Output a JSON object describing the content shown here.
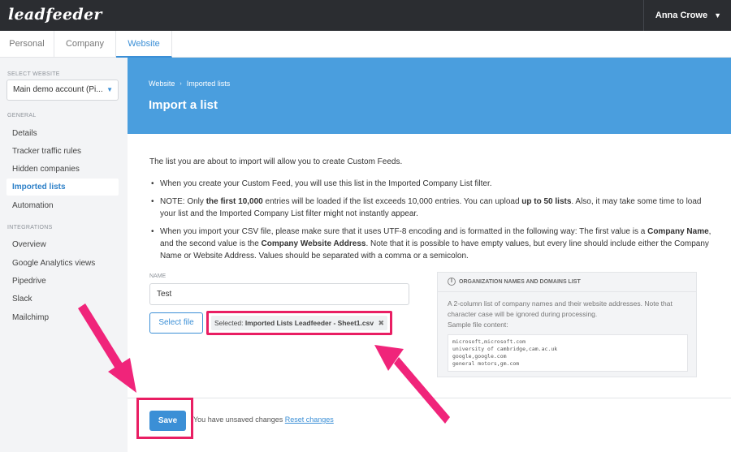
{
  "app": {
    "brand": "leadfeeder",
    "user_name": "Anna Crowe",
    "accent": "#3b8fd6",
    "highlight": "#e91e63"
  },
  "tabs": [
    {
      "label": "Personal"
    },
    {
      "label": "Company"
    },
    {
      "label": "Website",
      "active": true
    }
  ],
  "sidebar": {
    "select_website_label": "SELECT WEBSITE",
    "selected_website": "Main demo account (Pi...",
    "general_label": "GENERAL",
    "general_items": [
      {
        "label": "Details"
      },
      {
        "label": "Tracker traffic rules"
      },
      {
        "label": "Hidden companies"
      },
      {
        "label": "Imported lists",
        "active": true
      },
      {
        "label": "Automation"
      }
    ],
    "integrations_label": "INTEGRATIONS",
    "integration_items": [
      {
        "label": "Overview"
      },
      {
        "label": "Google Analytics views"
      },
      {
        "label": "Pipedrive"
      },
      {
        "label": "Slack"
      },
      {
        "label": "Mailchimp"
      }
    ]
  },
  "banner": {
    "breadcrumb": [
      "Website",
      "Imported lists"
    ],
    "title": "Import a list"
  },
  "main": {
    "intro": "The list you are about to import will allow you to create Custom Feeds.",
    "note1": "When you create your Custom Feed, you will use this list in the Imported Company List filter.",
    "note2": {
      "a": "NOTE: Only ",
      "b": "the first 10,000",
      "c": " entries will be loaded if the list exceeds 10,000 entries. You can upload ",
      "d": "up to 50 lists",
      "e": ". Also, it may take some time to load your list and the Imported Company List filter might not instantly appear."
    },
    "note3": {
      "a": "When you import your CSV file, please make sure that it uses UTF-8 encoding and is formatted in the following way: The first value is a ",
      "b": "Company Name",
      "c": ", and the second value is the ",
      "d": "Company Website Address",
      "e": ". Note that it is possible to have empty values, but every line should include either the Company Name or Website Address. Values should be separated with a comma or a semicolon."
    },
    "name_label": "NAME",
    "name_value": "Test",
    "select_file_label": "Select file",
    "selected_prefix": "Selected: ",
    "selected_file": "Imported Lists Leadfeeder - Sheet1.csv"
  },
  "info_box": {
    "title": "ORGANIZATION NAMES AND DOMAINS LIST",
    "text": "A 2-column list of company names and their website addresses. Note that character case will be ignored during processing.",
    "sample_label": "Sample file content:",
    "sample_lines": "microsoft,microsoft.com\nuniversity of cambridge,cam.ac.uk\ngoogle,google.com\ngeneral motors,gm.com"
  },
  "footer": {
    "save_label": "Save",
    "unsaved_text": "You have unsaved changes ",
    "reset_label": "Reset changes"
  }
}
